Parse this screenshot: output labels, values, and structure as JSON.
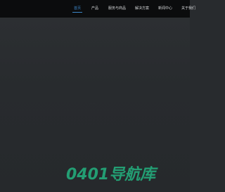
{
  "nav": {
    "items": [
      {
        "label": "首页",
        "active": true
      },
      {
        "label": "产品",
        "active": false
      },
      {
        "label": "服务与商品",
        "active": false
      },
      {
        "label": "解决方案",
        "active": false
      },
      {
        "label": "新闻中心",
        "active": false
      },
      {
        "label": "关于我们",
        "active": false
      }
    ]
  },
  "main": {
    "center_hint": "· · · · · ·"
  },
  "watermark": {
    "text": "0401导航库",
    "color": "#23a87a"
  },
  "colors": {
    "topbar": "#0b0c0d",
    "background": "#282b2e",
    "nav_active": "#3d86c6",
    "nav_text": "#d6d8da"
  }
}
